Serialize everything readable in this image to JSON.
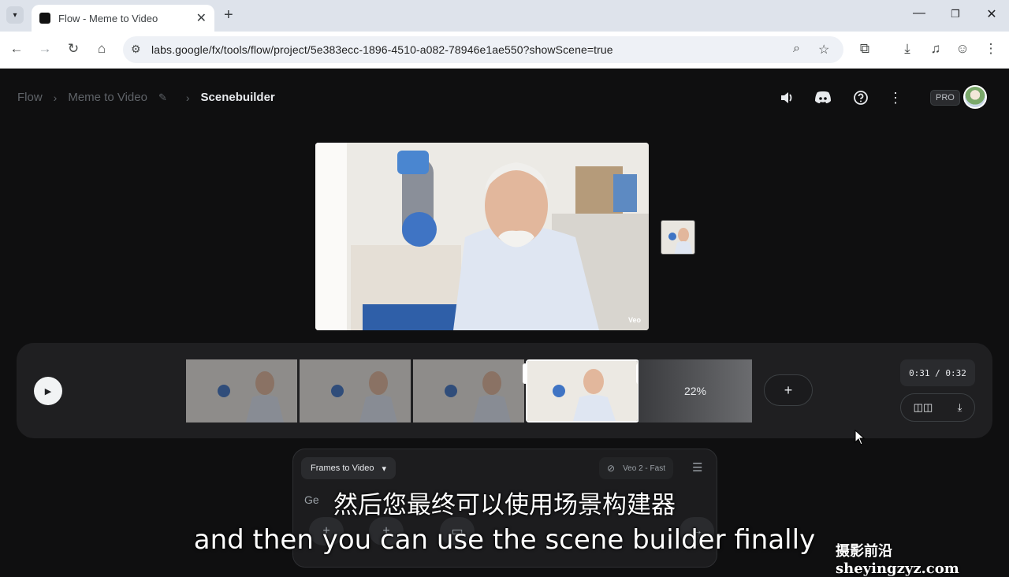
{
  "browser": {
    "tab_title": "Flow - Meme to Video",
    "url": "labs.google/fx/tools/flow/project/5e383ecc-1896-4510-a082-78946e1ae550?showScene=true"
  },
  "breadcrumbs": {
    "root": "Flow",
    "project": "Meme to Video",
    "current": "Scenebuilder"
  },
  "header": {
    "plan_badge": "PRO"
  },
  "preview": {
    "watermark": "Veo"
  },
  "timeline": {
    "generating_progress": "22%",
    "time_readout": "0:31 / 0:32",
    "add_label": "+"
  },
  "prompt": {
    "mode_label": "Frames to Video",
    "model_label": "Veo 2 - Fast",
    "input_value": "Ge"
  },
  "subtitles": {
    "chinese": "然后您最终可以使用场景构建器",
    "english": "and then you can use the scene builder finally"
  },
  "watermark_site": "摄影前沿 sheyingzyz.com"
}
